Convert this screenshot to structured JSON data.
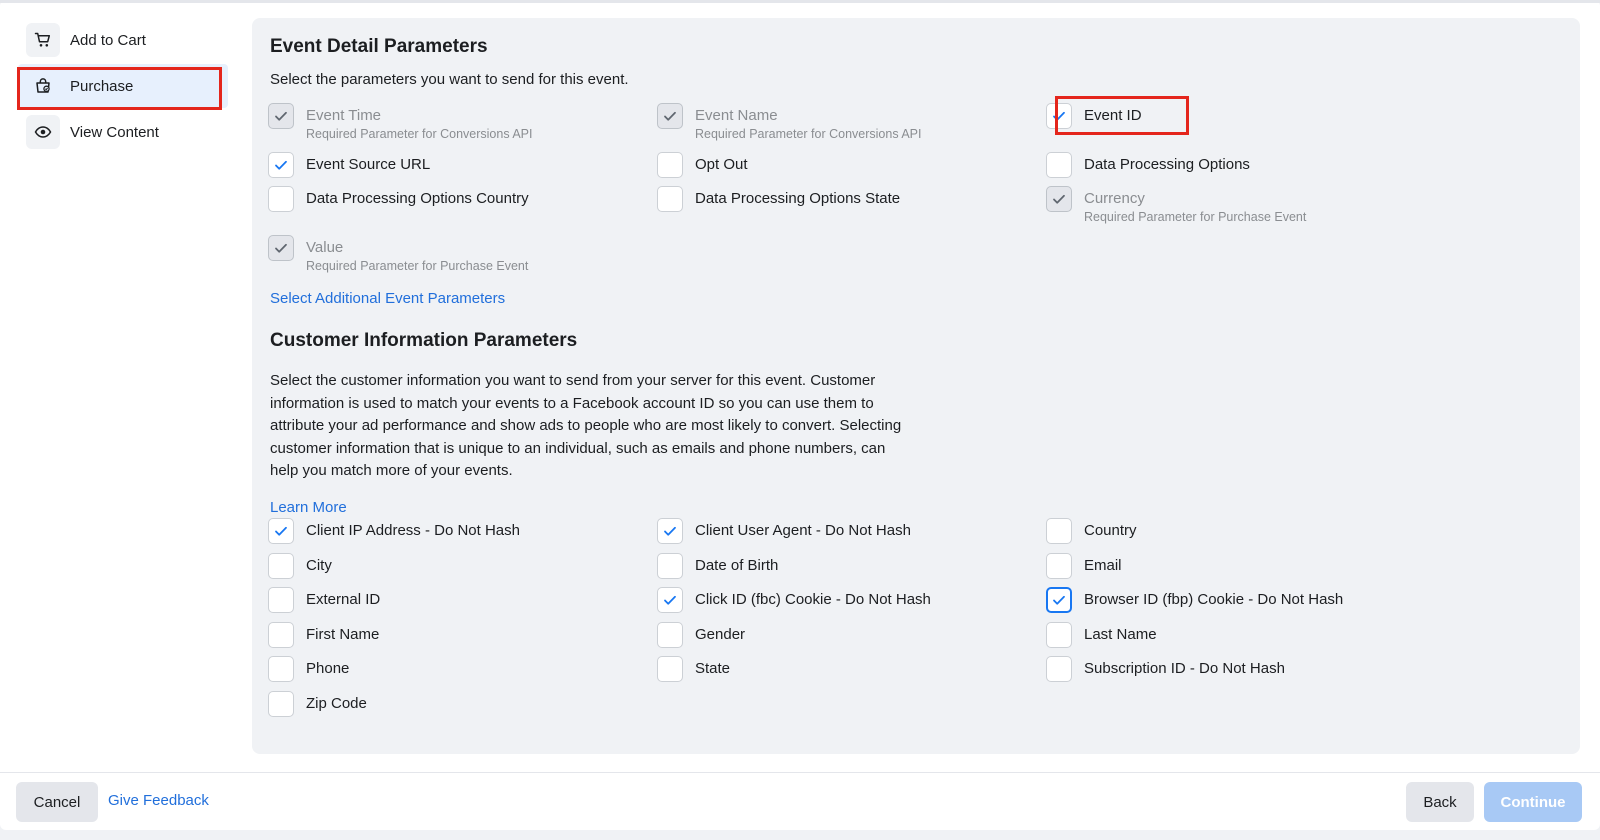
{
  "sidebar": {
    "items": [
      {
        "label": "Add to Cart",
        "icon": "cart-icon"
      },
      {
        "label": "Purchase",
        "icon": "shopping-bag-icon"
      },
      {
        "label": "View Content",
        "icon": "eye-icon"
      }
    ]
  },
  "event_section": {
    "title": "Event Detail Parameters",
    "subtitle": "Select the parameters you want to send for this event.",
    "params": [
      {
        "label": "Event Time",
        "note": "Required Parameter for Conversions API",
        "checked": true,
        "disabled": true
      },
      {
        "label": "Event Name",
        "note": "Required Parameter for Conversions API",
        "checked": true,
        "disabled": true
      },
      {
        "label": "Event ID",
        "note": "",
        "checked": true,
        "disabled": false
      },
      {
        "label": "Event Source URL",
        "note": "",
        "checked": true,
        "disabled": false
      },
      {
        "label": "Opt Out",
        "note": "",
        "checked": false,
        "disabled": false
      },
      {
        "label": "Data Processing Options",
        "note": "",
        "checked": false,
        "disabled": false
      },
      {
        "label": "Data Processing Options Country",
        "note": "",
        "checked": false,
        "disabled": false
      },
      {
        "label": "Data Processing Options State",
        "note": "",
        "checked": false,
        "disabled": false
      },
      {
        "label": "Currency",
        "note": "Required Parameter for Purchase Event",
        "checked": true,
        "disabled": true
      },
      {
        "label": "Value",
        "note": "Required Parameter for Purchase Event",
        "checked": true,
        "disabled": true
      }
    ],
    "additional_link": "Select Additional Event Parameters"
  },
  "customer_section": {
    "title": "Customer Information Parameters",
    "description": "Select the customer information you want to send from your server for this event. Customer information is used to match your events to a Facebook account ID so you can use them to attribute your ad performance and show ads to people who are most likely to convert. Selecting customer information that is unique to an individual, such as emails and phone numbers, can help you match more of your events.",
    "learn_more": "Learn More",
    "params": [
      {
        "label": "Client IP Address - Do Not Hash",
        "checked": true
      },
      {
        "label": "Client User Agent - Do Not Hash",
        "checked": true
      },
      {
        "label": "Country",
        "checked": false
      },
      {
        "label": "City",
        "checked": false
      },
      {
        "label": "Date of Birth",
        "checked": false
      },
      {
        "label": "Email",
        "checked": false
      },
      {
        "label": "External ID",
        "checked": false
      },
      {
        "label": "Click ID (fbc) Cookie - Do Not Hash",
        "checked": true
      },
      {
        "label": "Browser ID (fbp) Cookie - Do Not Hash",
        "checked": true
      },
      {
        "label": "First Name",
        "checked": false
      },
      {
        "label": "Gender",
        "checked": false
      },
      {
        "label": "Last Name",
        "checked": false
      },
      {
        "label": "Phone",
        "checked": false
      },
      {
        "label": "State",
        "checked": false
      },
      {
        "label": "Subscription ID - Do Not Hash",
        "checked": false
      },
      {
        "label": "Zip Code",
        "checked": false
      }
    ]
  },
  "footer": {
    "cancel_label": "Cancel",
    "feedback_label": "Give Feedback",
    "back_label": "Back",
    "continue_label": "Continue"
  },
  "colors": {
    "accent": "#1877f2",
    "link": "#216fdb",
    "highlight": "#e4261c",
    "disabled_primary": "#a8c9f5"
  }
}
